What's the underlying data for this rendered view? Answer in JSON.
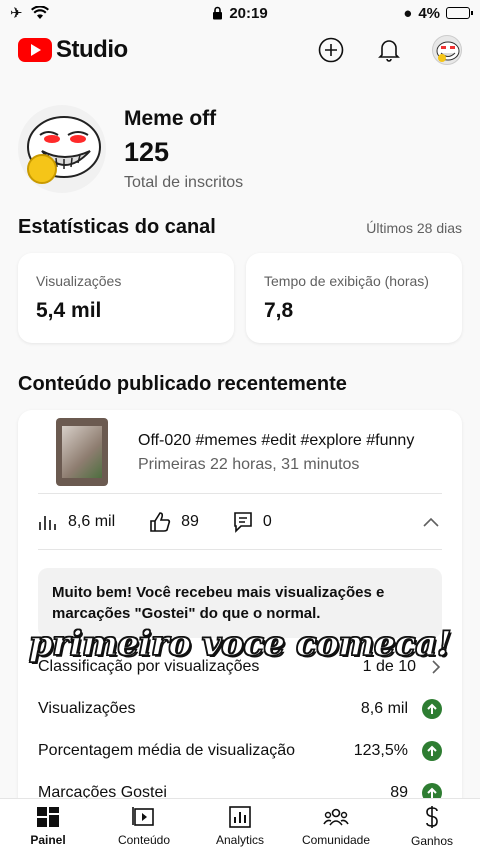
{
  "status_bar": {
    "time": "20:19",
    "battery": "4%"
  },
  "header": {
    "logo_text": "Studio",
    "icons": [
      "add-icon",
      "bell-icon",
      "avatar"
    ]
  },
  "channel": {
    "name": "Meme off",
    "subscribers": "125",
    "subscribers_label": "Total de inscritos"
  },
  "stats": {
    "title": "Estatísticas do canal",
    "period": "Últimos 28 dias",
    "cards": [
      {
        "label": "Visualizações",
        "value": "5,4 mil"
      },
      {
        "label": "Tempo de exibição (horas)",
        "value": "7,8"
      }
    ]
  },
  "recent": {
    "title": "Conteúdo publicado recentemente",
    "video": {
      "title": "Off-020 #memes #edit #explore #funny",
      "time": "Primeiras 22 horas, 31 minutos",
      "views": "8,6 mil",
      "likes": "89",
      "comments": "0"
    },
    "note": "Muito bem! Você recebeu mais visualizações e marcações \"Gostei\" do que o normal.",
    "rows": [
      {
        "label": "Classificação por visualizações",
        "value": "1 de 10"
      },
      {
        "label": "Visualizações",
        "value": "8,6 mil"
      },
      {
        "label": "Porcentagem média de visualização",
        "value": "123,5%"
      },
      {
        "label": "Marcações Gostei",
        "value": "89"
      }
    ]
  },
  "overlay_caption": "primeiro voce comeca!",
  "nav": [
    {
      "label": "Painel",
      "icon": "dashboard-icon"
    },
    {
      "label": "Conteúdo",
      "icon": "content-icon"
    },
    {
      "label": "Analytics",
      "icon": "analytics-icon"
    },
    {
      "label": "Comunidade",
      "icon": "community-icon"
    },
    {
      "label": "Ganhos",
      "icon": "dollar-icon"
    }
  ],
  "colors": {
    "brand_red": "#ff0000",
    "positive_green": "#2e7d32"
  }
}
